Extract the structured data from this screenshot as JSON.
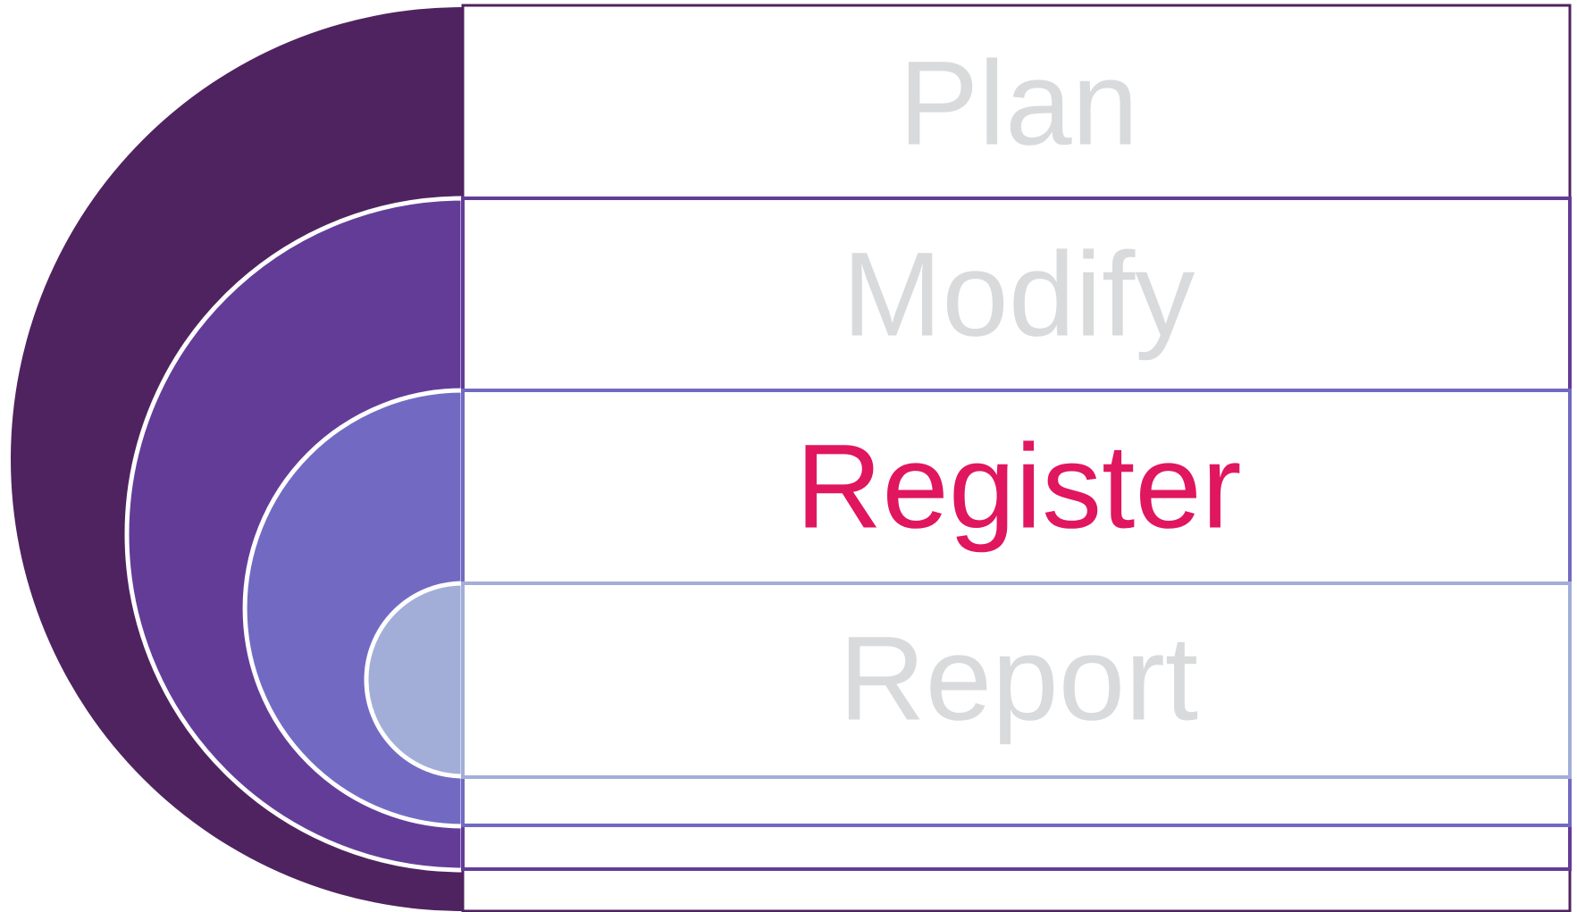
{
  "diagram": {
    "type": "nested-semicircle-steps",
    "steps": [
      {
        "label": "Plan",
        "active": false
      },
      {
        "label": "Modify",
        "active": false
      },
      {
        "label": "Register",
        "active": true
      },
      {
        "label": "Report",
        "active": false
      }
    ]
  },
  "colors": {
    "arc_1": "#4f235f",
    "arc_2": "#633c98",
    "arc_3": "#726ac2",
    "arc_4": "#a2aed8",
    "label_inactive": "#d9dadb",
    "label_active": "#e0165f",
    "background": "#ffffff",
    "ring_outline": "#ffffff"
  }
}
